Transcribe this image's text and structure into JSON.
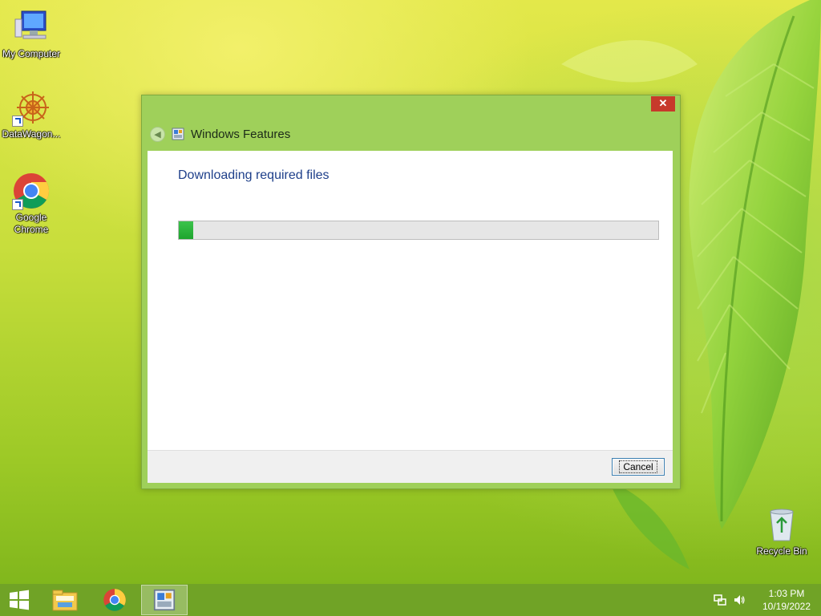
{
  "desktop": {
    "icons": [
      {
        "label": "My Computer"
      },
      {
        "label": "DataWagon..."
      },
      {
        "label": "Google Chrome"
      },
      {
        "label": "Recycle Bin"
      }
    ]
  },
  "window": {
    "title": "Windows Features",
    "close_label": "✕",
    "heading": "Downloading required files",
    "progress_fraction": 0.03,
    "cancel_label": "Cancel",
    "accent_color": "#9fd05a"
  },
  "taskbar": {
    "apps": [
      "file-explorer-icon",
      "chrome-icon",
      "windows-features-icon"
    ],
    "time": "1:03 PM",
    "date": "10/19/2022"
  }
}
